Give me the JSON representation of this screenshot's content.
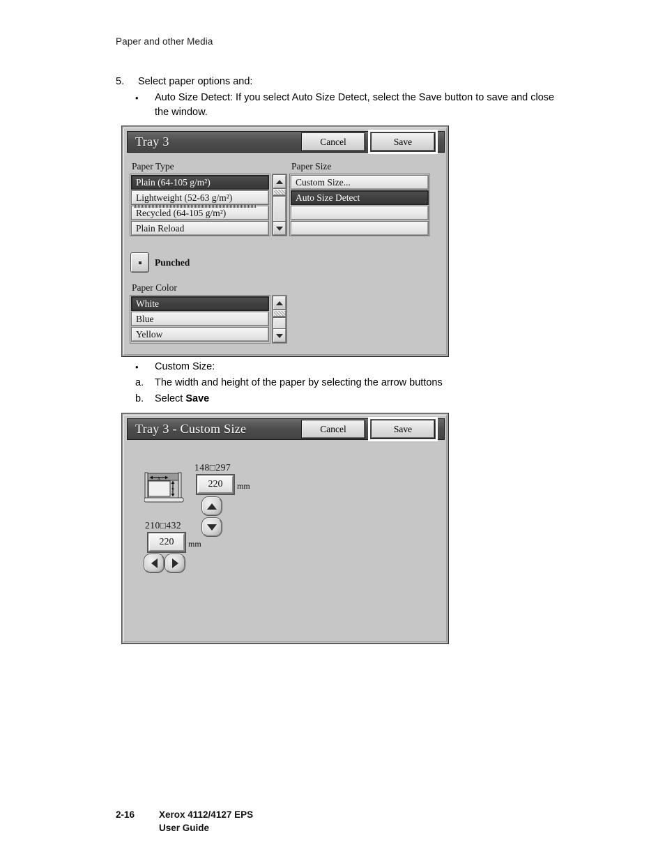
{
  "page": {
    "running_head": "Paper and other Media",
    "footer_page_number": "2-16",
    "footer_line1": "Xerox 4112/4127 EPS",
    "footer_line2": "User Guide"
  },
  "step5": {
    "number": "5.",
    "text": "Select paper options and:",
    "bullet_mark": "•",
    "bullet_text": "Auto Size Detect: If you select Auto Size Detect, select the Save button to save and close the window."
  },
  "mid_list": {
    "bullet_mark": "•",
    "bullet_text": "Custom Size:",
    "item_a_mark": "a.",
    "item_a_text": "The width and height of the paper by selecting the arrow buttons",
    "item_b_mark": "b.",
    "item_b_text_prefix": "Select ",
    "item_b_text_bold": "Save"
  },
  "dialog_tray3": {
    "title": "Tray 3",
    "cancel_label": "Cancel",
    "save_label": "Save",
    "paper_type_label": "Paper Type",
    "paper_type_items": [
      {
        "label": "Plain (64-105 g/m²)",
        "selected": true
      },
      {
        "label": "Lightweight (52-63 g/m²)",
        "selected": false
      },
      {
        "label": "Recycled (64-105 g/m²)",
        "selected": false
      },
      {
        "label": "Plain Reload",
        "selected": false
      }
    ],
    "paper_size_label": "Paper Size",
    "paper_size_items": [
      {
        "label": "Custom Size...",
        "selected": false
      },
      {
        "label": "Auto Size Detect",
        "selected": true
      },
      {
        "label": "",
        "selected": false
      },
      {
        "label": "",
        "selected": false
      }
    ],
    "punched_label": "Punched",
    "paper_color_label": "Paper Color",
    "paper_color_items": [
      {
        "label": "White",
        "selected": true
      },
      {
        "label": "Blue",
        "selected": false
      },
      {
        "label": "Yellow",
        "selected": false
      }
    ]
  },
  "dialog_custom_size": {
    "title": "Tray 3 - Custom Size",
    "cancel_label": "Cancel",
    "save_label": "Save",
    "height_range": "148□297",
    "height_value": "220",
    "height_unit": "mm",
    "width_range": "210□432",
    "width_value": "220",
    "width_unit": "mm"
  }
}
